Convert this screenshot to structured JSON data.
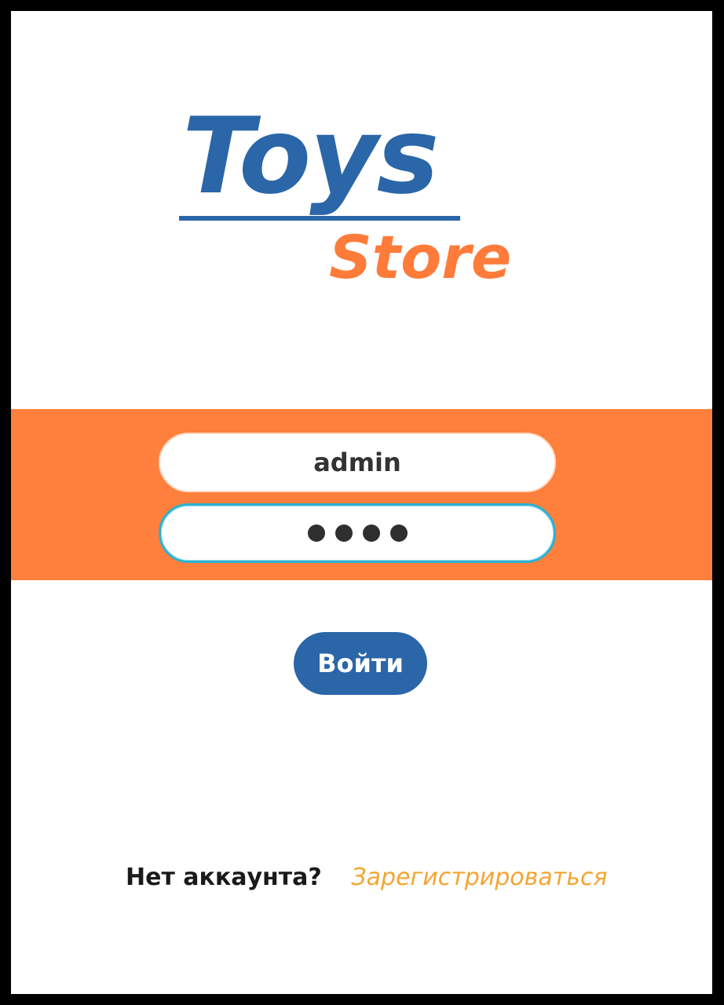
{
  "logo": {
    "line1": "Toys",
    "line2": "Store",
    "colors": {
      "primary": "#2a66a8",
      "accent": "#ff7b3a"
    }
  },
  "login_form": {
    "login_value": "admin",
    "password_masked": "••••",
    "band_color": "#ff7f3c",
    "focused_field_border": "#2bb1d0"
  },
  "submit_button": {
    "label": "Войти",
    "color": "#2a66a8"
  },
  "register": {
    "prompt": "Нет аккаунта?",
    "link_label": "Зарегистрироваться",
    "link_color": "#f4a533"
  }
}
